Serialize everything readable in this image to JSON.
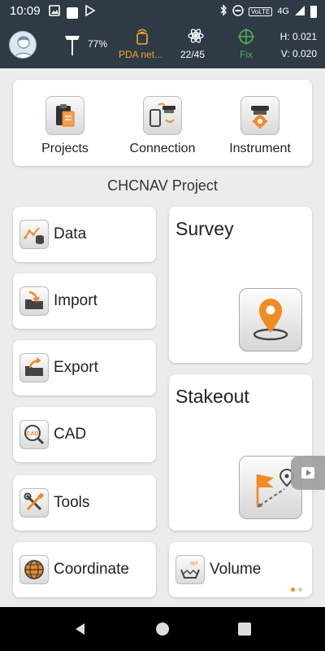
{
  "status_bar": {
    "time": "10:09",
    "network": "4G",
    "network_sup": "4G"
  },
  "header": {
    "battery_percent": "77%",
    "pda_label": "PDA net...",
    "satellites": "22/45",
    "fix_status": "Fix",
    "h_precision": "H: 0.021",
    "v_precision": "V: 0.020"
  },
  "top_menu": [
    {
      "label": "Projects",
      "icon": "projects-clipboard-icon"
    },
    {
      "label": "Connection",
      "icon": "connection-icon"
    },
    {
      "label": "Instrument",
      "icon": "instrument-gear-icon"
    }
  ],
  "project_name": "CHCNAV Project",
  "list_items": [
    {
      "label": "Data",
      "icon": "data-icon"
    },
    {
      "label": "Import",
      "icon": "import-folder-icon"
    },
    {
      "label": "Export",
      "icon": "export-folder-icon"
    },
    {
      "label": "CAD",
      "icon": "cad-icon"
    },
    {
      "label": "Tools",
      "icon": "tools-icon"
    },
    {
      "label": "Coordinate",
      "icon": "coordinate-globe-icon"
    }
  ],
  "big_items": {
    "survey": {
      "label": "Survey",
      "icon": "survey-pin-icon"
    },
    "stakeout": {
      "label": "Stakeout",
      "icon": "stakeout-flag-icon"
    },
    "volume": {
      "label": "Volume",
      "icon": "volume-icon",
      "sup": "m³"
    }
  },
  "colors": {
    "header_bg": "#2e3a45",
    "accent_orange": "#f08a24",
    "pda_orange": "#f5a623",
    "fix_green": "#4caf50"
  }
}
